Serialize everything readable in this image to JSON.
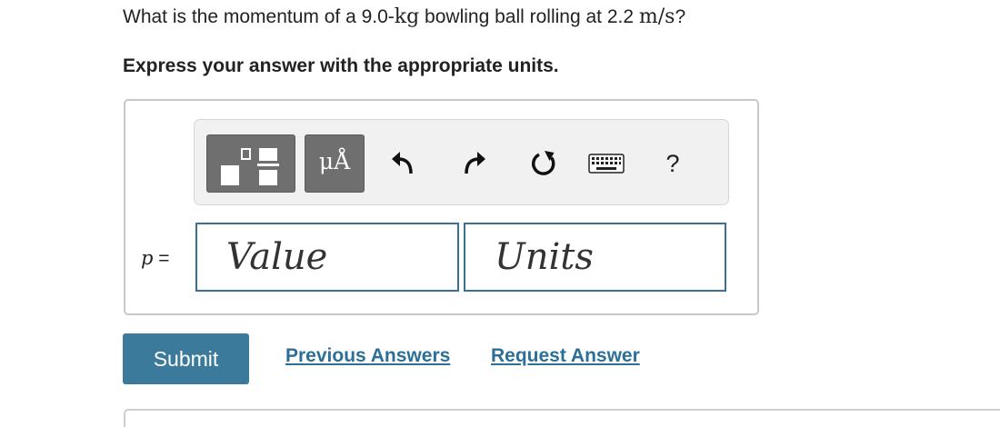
{
  "question": {
    "prefix": "What is the momentum of a 9.0-",
    "mass_unit": "kg",
    "middle": " bowling ball rolling at 2.2 ",
    "speed_unit": "m/s",
    "suffix": "?"
  },
  "instruction": "Express your answer with the appropriate units.",
  "toolbar": {
    "templates_icon": "fraction-template-icon",
    "units_label": "μÅ",
    "undo_icon": "undo-arrow-icon",
    "redo_icon": "redo-arrow-icon",
    "reset_icon": "reset-icon",
    "keyboard_icon": "keyboard-icon",
    "help_label": "?"
  },
  "answer": {
    "variable": "p",
    "equals": " =",
    "value_placeholder": "Value",
    "value_text": "",
    "units_placeholder": "Units",
    "units_text": ""
  },
  "actions": {
    "submit_label": "Submit",
    "previous_answers_label": "Previous Answers",
    "request_answer_label": "Request Answer"
  },
  "colors": {
    "accent": "#3b7a9a",
    "link": "#2c6f97",
    "toolbar_button": "#6f6f6f",
    "input_border": "#3a7190"
  }
}
